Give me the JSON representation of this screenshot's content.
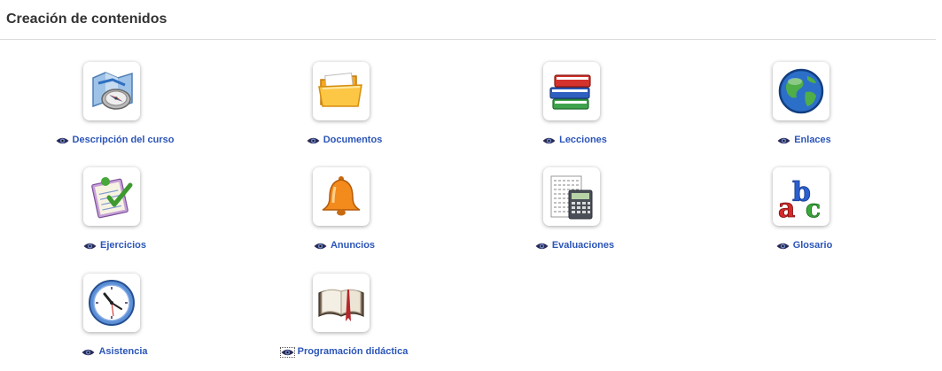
{
  "section": {
    "title": "Creación de contenidos"
  },
  "tools": [
    {
      "label": "Descripción del curso",
      "icon": "compass-map-icon"
    },
    {
      "label": "Documentos",
      "icon": "folder-icon"
    },
    {
      "label": "Lecciones",
      "icon": "books-icon"
    },
    {
      "label": "Enlaces",
      "icon": "globe-icon"
    },
    {
      "label": "Ejercicios",
      "icon": "checklist-icon"
    },
    {
      "label": "Anuncios",
      "icon": "bell-icon"
    },
    {
      "label": "Evaluaciones",
      "icon": "calculator-icon"
    },
    {
      "label": "Glosario",
      "icon": "abc-icon"
    },
    {
      "label": "Asistencia",
      "icon": "clock-icon"
    },
    {
      "label": "Programación didáctica",
      "icon": "open-book-icon"
    }
  ],
  "colors": {
    "link": "#2b55b8",
    "title": "#333333"
  }
}
